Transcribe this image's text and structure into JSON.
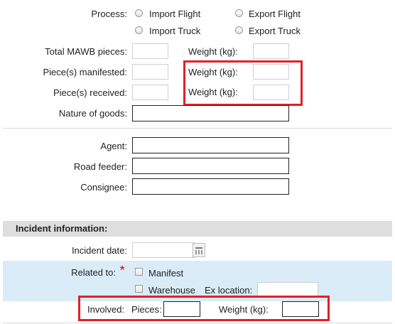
{
  "form": {
    "process_label": "Process:",
    "process_options": [
      "Import Flight",
      "Export Flight",
      "Import Truck",
      "Export Truck"
    ],
    "total_mawb_label": "Total MAWB pieces:",
    "pieces_manifested_label": "Piece(s) manifested:",
    "pieces_received_label": "Piece(s) received:",
    "weight_label": "Weight (kg):",
    "nature_label": "Nature of goods:",
    "agent_label": "Agent:",
    "road_feeder_label": "Road feeder:",
    "consignee_label": "Consignee:"
  },
  "incident": {
    "section_title": "Incident information:",
    "date_label": "Incident date:",
    "related_label": "Related to:",
    "required_mark": "*",
    "manifest_label": "Manifest",
    "warehouse_label": "Warehouse",
    "ex_location_label": "Ex location:",
    "involved_label": "Involved:",
    "pieces_label": "Pieces:",
    "weight_label": "Weight (kg):"
  },
  "colors": {
    "highlight": "#e0202a",
    "blue_band": "#d9ecf8",
    "section_header": "#dedede"
  }
}
